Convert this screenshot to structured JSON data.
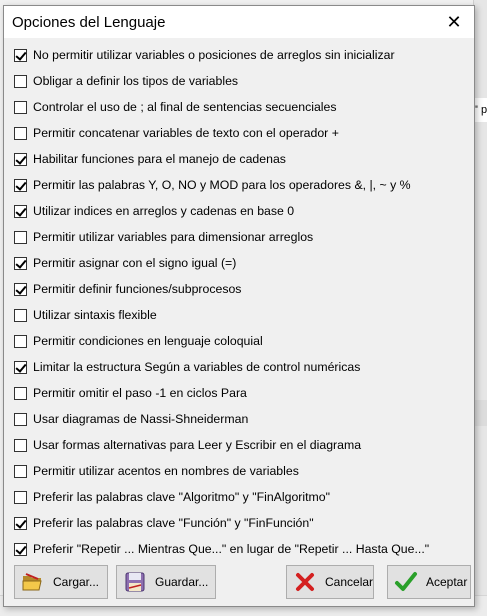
{
  "dialog": {
    "title": "Opciones del Lenguaje"
  },
  "options": [
    {
      "label": "No permitir utilizar variables o posiciones de arreglos sin inicializar",
      "checked": true
    },
    {
      "label": "Obligar a definir los tipos de variables",
      "checked": false
    },
    {
      "label": "Controlar el uso de ; al final de sentencias secuenciales",
      "checked": false
    },
    {
      "label": "Permitir concatenar variables de texto con el operador +",
      "checked": false
    },
    {
      "label": "Habilitar funciones para el manejo de cadenas",
      "checked": true
    },
    {
      "label": "Permitir las palabras Y, O, NO y MOD para los operadores &, |, ~ y %",
      "checked": true
    },
    {
      "label": "Utilizar indices en arreglos y cadenas en base 0",
      "checked": true
    },
    {
      "label": "Permitir utilizar variables para dimensionar arreglos",
      "checked": false
    },
    {
      "label": "Permitir asignar con el signo igual (=)",
      "checked": true
    },
    {
      "label": "Permitir definir funciones/subprocesos",
      "checked": true
    },
    {
      "label": "Utilizar sintaxis flexible",
      "checked": false
    },
    {
      "label": "Permitir condiciones en lenguaje coloquial",
      "checked": false
    },
    {
      "label": "Limitar la estructura Según a variables de control numéricas",
      "checked": true
    },
    {
      "label": "Permitir omitir el paso -1 en ciclos Para",
      "checked": false
    },
    {
      "label": "Usar diagramas de Nassi-Shneiderman",
      "checked": false
    },
    {
      "label": "Usar formas alternativas para Leer y Escribir en el diagrama",
      "checked": false
    },
    {
      "label": "Permitir utilizar acentos en nombres de variables",
      "checked": false
    },
    {
      "label": "Preferir las palabras clave \"Algoritmo\" y \"FinAlgoritmo\"",
      "checked": false
    },
    {
      "label": "Preferir las palabras clave \"Función\" y \"FinFunción\"",
      "checked": true
    },
    {
      "label": "Preferir \"Repetir ... Mientras Que...\" en lugar de \"Repetir ... Hasta Que...\"",
      "checked": true
    }
  ],
  "buttons": {
    "cargar": {
      "label": "Cargar...",
      "icon": "folder-open-icon"
    },
    "guardar": {
      "label": "Guardar...",
      "icon": "floppy-disk-icon"
    },
    "cancelar": {
      "label": "Cancelar",
      "icon": "red-x-icon"
    },
    "aceptar": {
      "label": "Aceptar",
      "icon": "green-check-icon"
    }
  },
  "background": {
    "fragment_text": "\" p"
  },
  "colors": {
    "cancel_x": "#d42020",
    "accept_check": "#2aa02a"
  }
}
